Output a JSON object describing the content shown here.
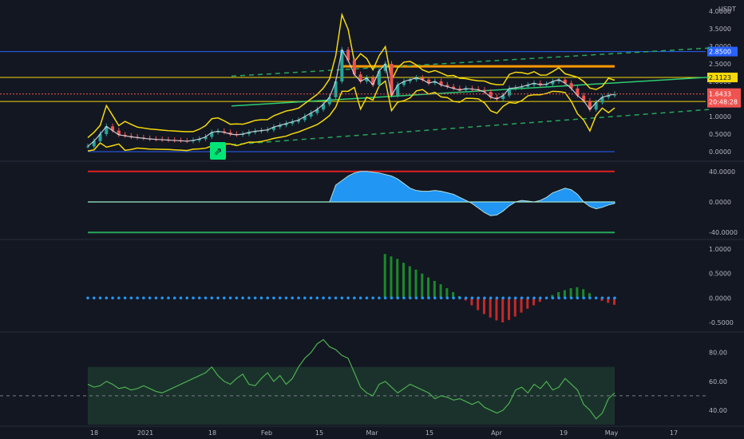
{
  "chart_data": {
    "type": "line",
    "currency": "USDT",
    "x_ticks": [
      "18",
      "2021",
      "18",
      "Feb",
      "15",
      "Mar",
      "15",
      "Apr",
      "19",
      "May",
      "17"
    ],
    "price_panel": {
      "y_ticks": [
        4.0,
        3.5,
        3.0,
        2.5,
        2.0,
        1.5,
        1.0,
        0.5,
        0.0
      ],
      "ylim": [
        0,
        4.0
      ],
      "current_price": 1.6433,
      "countdown": "20:48:28",
      "levels": [
        {
          "label": "2.8500",
          "value": 2.85,
          "color": "#2962ff"
        },
        {
          "label": "2.1123",
          "value": 2.1123,
          "color": "#f5d90a"
        }
      ],
      "support_line": 1.43,
      "orange_level": 2.43,
      "signal_marker": "⇗",
      "series": [
        {
          "name": "close",
          "values": [
            0.15,
            0.3,
            0.5,
            0.72,
            0.6,
            0.48,
            0.45,
            0.42,
            0.4,
            0.38,
            0.36,
            0.35,
            0.34,
            0.33,
            0.32,
            0.31,
            0.3,
            0.32,
            0.36,
            0.42,
            0.55,
            0.58,
            0.55,
            0.5,
            0.48,
            0.5,
            0.55,
            0.58,
            0.6,
            0.62,
            0.7,
            0.75,
            0.8,
            0.85,
            0.9,
            1.0,
            1.1,
            1.2,
            1.35,
            1.55,
            2.0,
            2.9,
            2.6,
            2.2,
            2.0,
            2.1,
            1.9,
            2.3,
            2.5,
            1.6,
            1.9,
            2.0,
            2.05,
            2.1,
            2.05,
            1.95,
            2.0,
            1.9,
            1.85,
            1.8,
            1.75,
            1.8,
            1.78,
            1.76,
            1.7,
            1.55,
            1.5,
            1.6,
            1.8,
            1.82,
            1.85,
            1.9,
            1.95,
            1.9,
            1.92,
            2.0,
            2.05,
            1.95,
            1.8,
            1.6,
            1.45,
            1.2,
            1.4,
            1.55,
            1.6,
            1.64
          ]
        }
      ]
    },
    "oscillator_panel": {
      "y_ticks": [
        40.0,
        0.0,
        -40.0
      ],
      "ylim": [
        -45,
        45
      ],
      "upper_line": 40,
      "lower_line": -40,
      "series": [
        {
          "name": "wave",
          "values": [
            0,
            0,
            0,
            0,
            0,
            0,
            0,
            0,
            0,
            0,
            0,
            0,
            0,
            0,
            0,
            0,
            0,
            0,
            0,
            0,
            0,
            0,
            0,
            0,
            0,
            0,
            0,
            0,
            0,
            0,
            0,
            0,
            0,
            0,
            0,
            0,
            0,
            0,
            0,
            0,
            22,
            28,
            34,
            38,
            40,
            40,
            39,
            38,
            36,
            34,
            30,
            24,
            18,
            15,
            14,
            14,
            15,
            14,
            12,
            10,
            6,
            2,
            -2,
            -8,
            -14,
            -18,
            -17,
            -12,
            -5,
            0,
            2,
            1,
            0,
            2,
            6,
            12,
            15,
            18,
            16,
            10,
            0,
            -6,
            -9,
            -7,
            -4,
            -2
          ]
        }
      ]
    },
    "momentum_panel": {
      "y_ticks": [
        1.0,
        0.5,
        0.0,
        -0.5
      ],
      "ylim": [
        -0.6,
        1.1
      ],
      "series": [
        {
          "name": "histogram",
          "values": [
            0,
            0,
            0,
            0,
            0,
            0,
            0,
            0,
            0,
            0,
            0,
            0,
            0,
            0,
            0,
            0,
            0,
            0,
            0,
            0,
            0,
            0,
            0,
            0,
            0,
            0,
            0,
            0,
            0,
            0,
            0,
            0,
            0,
            0,
            0,
            0,
            0,
            0,
            0,
            0,
            0,
            0,
            0,
            0,
            0,
            0,
            0,
            0,
            0.9,
            0.85,
            0.8,
            0.72,
            0.65,
            0.58,
            0.5,
            0.42,
            0.35,
            0.28,
            0.2,
            0.12,
            0.04,
            -0.05,
            -0.15,
            -0.25,
            -0.33,
            -0.4,
            -0.46,
            -0.5,
            -0.45,
            -0.38,
            -0.3,
            -0.22,
            -0.15,
            -0.08,
            0,
            0.06,
            0.12,
            0.16,
            0.2,
            0.22,
            0.18,
            0.1,
            0,
            -0.06,
            -0.1,
            -0.14
          ]
        }
      ]
    },
    "rsi_panel": {
      "y_ticks": [
        80.0,
        60.0,
        40.0
      ],
      "ylim": [
        30,
        92
      ],
      "band": [
        30,
        70
      ],
      "midline": 50,
      "series": [
        {
          "name": "rsi",
          "values": [
            58,
            56,
            57,
            60,
            58,
            55,
            56,
            54,
            55,
            57,
            55,
            53,
            52,
            54,
            56,
            58,
            60,
            62,
            64,
            66,
            70,
            64,
            60,
            58,
            62,
            65,
            58,
            57,
            62,
            66,
            60,
            64,
            58,
            62,
            70,
            76,
            80,
            86,
            89,
            84,
            82,
            78,
            76,
            66,
            56,
            52,
            50,
            58,
            60,
            56,
            52,
            55,
            58,
            56,
            54,
            52,
            48,
            50,
            49,
            47,
            48,
            46,
            44,
            46,
            42,
            40,
            38,
            40,
            45,
            54,
            56,
            52,
            58,
            55,
            60,
            54,
            56,
            62,
            58,
            54,
            44,
            40,
            34,
            38,
            48,
            52
          ]
        }
      ]
    }
  }
}
